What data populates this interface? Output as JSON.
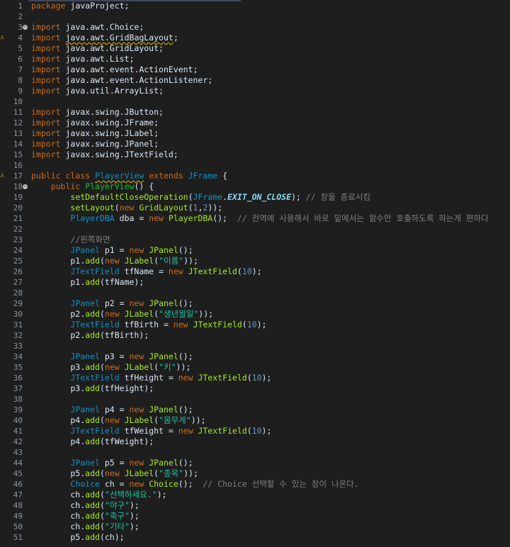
{
  "editor": {
    "lines": [
      {
        "n": "1",
        "parts": [
          [
            "k",
            "package"
          ],
          [
            "p",
            " javaProject;"
          ]
        ]
      },
      {
        "n": "2",
        "parts": []
      },
      {
        "n": "3",
        "fold": true,
        "parts": [
          [
            "k",
            "import"
          ],
          [
            "p",
            " java.awt.Choice;"
          ]
        ]
      },
      {
        "n": "4",
        "warn": true,
        "parts": [
          [
            "k",
            "import"
          ],
          [
            "p",
            " "
          ],
          [
            "u",
            "java.awt.GridBagLayout"
          ],
          [
            "p",
            ";"
          ]
        ]
      },
      {
        "n": "5",
        "parts": [
          [
            "k",
            "import"
          ],
          [
            "p",
            " java.awt.GridLayout;"
          ]
        ]
      },
      {
        "n": "6",
        "parts": [
          [
            "k",
            "import"
          ],
          [
            "p",
            " java.awt.List;"
          ]
        ]
      },
      {
        "n": "7",
        "parts": [
          [
            "k",
            "import"
          ],
          [
            "p",
            " java.awt.event.ActionEvent;"
          ]
        ]
      },
      {
        "n": "8",
        "parts": [
          [
            "k",
            "import"
          ],
          [
            "p",
            " java.awt.event.ActionListener;"
          ]
        ]
      },
      {
        "n": "9",
        "parts": [
          [
            "k",
            "import"
          ],
          [
            "p",
            " java.util.ArrayList;"
          ]
        ]
      },
      {
        "n": "10",
        "parts": []
      },
      {
        "n": "11",
        "parts": [
          [
            "k",
            "import"
          ],
          [
            "p",
            " javax.swing.JButton;"
          ]
        ]
      },
      {
        "n": "12",
        "parts": [
          [
            "k",
            "import"
          ],
          [
            "p",
            " javax.swing.JFrame;"
          ]
        ]
      },
      {
        "n": "13",
        "parts": [
          [
            "k",
            "import"
          ],
          [
            "p",
            " javax.swing.JLabel;"
          ]
        ]
      },
      {
        "n": "14",
        "parts": [
          [
            "k",
            "import"
          ],
          [
            "p",
            " javax.swing.JPanel;"
          ]
        ]
      },
      {
        "n": "15",
        "parts": [
          [
            "k",
            "import"
          ],
          [
            "p",
            " javax.swing.JTextField;"
          ]
        ]
      },
      {
        "n": "16",
        "parts": []
      },
      {
        "n": "17",
        "warn": true,
        "parts": [
          [
            "k",
            "public class"
          ],
          [
            "p",
            " "
          ],
          [
            "tu",
            "PlayerView"
          ],
          [
            "p",
            " "
          ],
          [
            "k",
            "extends"
          ],
          [
            "p",
            " "
          ],
          [
            "t",
            "JFrame"
          ],
          [
            "p",
            " {"
          ]
        ]
      },
      {
        "n": "18",
        "fold": true,
        "parts": [
          [
            "p",
            "    "
          ],
          [
            "k",
            "public"
          ],
          [
            "p",
            " "
          ],
          [
            "f",
            "PlayerView"
          ],
          [
            "p",
            "() {"
          ]
        ]
      },
      {
        "n": "19",
        "parts": [
          [
            "p",
            "        "
          ],
          [
            "m",
            "setDefaultCloseOperation"
          ],
          [
            "p",
            "("
          ],
          [
            "t",
            "JFrame"
          ],
          [
            "p",
            "."
          ],
          [
            "it",
            "EXIT_ON_CLOSE"
          ],
          [
            "p",
            "); "
          ],
          [
            "c",
            "// 창을 종료시킴"
          ]
        ]
      },
      {
        "n": "20",
        "parts": [
          [
            "p",
            "        "
          ],
          [
            "m",
            "setLayout"
          ],
          [
            "p",
            "("
          ],
          [
            "k",
            "new"
          ],
          [
            "p",
            " "
          ],
          [
            "m",
            "GridLayout"
          ],
          [
            "p",
            "("
          ],
          [
            "n",
            "1"
          ],
          [
            "p",
            ","
          ],
          [
            "n",
            "2"
          ],
          [
            "p",
            "));"
          ]
        ]
      },
      {
        "n": "21",
        "parts": [
          [
            "p",
            "        "
          ],
          [
            "t",
            "PlayerDBA"
          ],
          [
            "p",
            " dba = "
          ],
          [
            "k",
            "new"
          ],
          [
            "p",
            " "
          ],
          [
            "m",
            "PlayerDBA"
          ],
          [
            "p",
            "();  "
          ],
          [
            "c",
            "// 전역에 사용해서 바로 밑에서는 함수만 호출하도록 하는게 편하다"
          ]
        ]
      },
      {
        "n": "22",
        "parts": []
      },
      {
        "n": "23",
        "parts": [
          [
            "p",
            "        "
          ],
          [
            "c",
            "//왼쪽화면"
          ]
        ]
      },
      {
        "n": "24",
        "parts": [
          [
            "p",
            "        "
          ],
          [
            "t",
            "JPanel"
          ],
          [
            "p",
            " p1 = "
          ],
          [
            "k",
            "new"
          ],
          [
            "p",
            " "
          ],
          [
            "m",
            "JPanel"
          ],
          [
            "p",
            "();"
          ]
        ]
      },
      {
        "n": "25",
        "parts": [
          [
            "p",
            "        p1."
          ],
          [
            "m",
            "add"
          ],
          [
            "p",
            "("
          ],
          [
            "k",
            "new"
          ],
          [
            "p",
            " "
          ],
          [
            "m",
            "JLabel"
          ],
          [
            "p",
            "("
          ],
          [
            "s",
            "\"이름\""
          ],
          [
            "p",
            "));"
          ]
        ]
      },
      {
        "n": "26",
        "parts": [
          [
            "p",
            "        "
          ],
          [
            "t",
            "JTextField"
          ],
          [
            "p",
            " tfName = "
          ],
          [
            "k",
            "new"
          ],
          [
            "p",
            " "
          ],
          [
            "m",
            "JTextField"
          ],
          [
            "p",
            "("
          ],
          [
            "n",
            "10"
          ],
          [
            "p",
            ");"
          ]
        ]
      },
      {
        "n": "27",
        "parts": [
          [
            "p",
            "        p1."
          ],
          [
            "m",
            "add"
          ],
          [
            "p",
            "(tfName);"
          ]
        ]
      },
      {
        "n": "28",
        "parts": []
      },
      {
        "n": "29",
        "parts": [
          [
            "p",
            "        "
          ],
          [
            "t",
            "JPanel"
          ],
          [
            "p",
            " p2 = "
          ],
          [
            "k",
            "new"
          ],
          [
            "p",
            " "
          ],
          [
            "m",
            "JPanel"
          ],
          [
            "p",
            "();"
          ]
        ]
      },
      {
        "n": "30",
        "parts": [
          [
            "p",
            "        p2."
          ],
          [
            "m",
            "add"
          ],
          [
            "p",
            "("
          ],
          [
            "k",
            "new"
          ],
          [
            "p",
            " "
          ],
          [
            "m",
            "JLabel"
          ],
          [
            "p",
            "("
          ],
          [
            "s",
            "\"생년월일\""
          ],
          [
            "p",
            "));"
          ]
        ]
      },
      {
        "n": "31",
        "parts": [
          [
            "p",
            "        "
          ],
          [
            "t",
            "JTextField"
          ],
          [
            "p",
            " tfBirth = "
          ],
          [
            "k",
            "new"
          ],
          [
            "p",
            " "
          ],
          [
            "m",
            "JTextField"
          ],
          [
            "p",
            "("
          ],
          [
            "n",
            "10"
          ],
          [
            "p",
            ");"
          ]
        ]
      },
      {
        "n": "32",
        "parts": [
          [
            "p",
            "        p2."
          ],
          [
            "m",
            "add"
          ],
          [
            "p",
            "(tfBirth);"
          ]
        ]
      },
      {
        "n": "33",
        "parts": []
      },
      {
        "n": "34",
        "parts": [
          [
            "p",
            "        "
          ],
          [
            "t",
            "JPanel"
          ],
          [
            "p",
            " p3 = "
          ],
          [
            "k",
            "new"
          ],
          [
            "p",
            " "
          ],
          [
            "m",
            "JPanel"
          ],
          [
            "p",
            "();"
          ]
        ]
      },
      {
        "n": "35",
        "parts": [
          [
            "p",
            "        p3."
          ],
          [
            "m",
            "add"
          ],
          [
            "p",
            "("
          ],
          [
            "k",
            "new"
          ],
          [
            "p",
            " "
          ],
          [
            "m",
            "JLabel"
          ],
          [
            "p",
            "("
          ],
          [
            "s",
            "\"키\""
          ],
          [
            "p",
            "));"
          ]
        ]
      },
      {
        "n": "36",
        "parts": [
          [
            "p",
            "        "
          ],
          [
            "t",
            "JTextField"
          ],
          [
            "p",
            " tfHeight = "
          ],
          [
            "k",
            "new"
          ],
          [
            "p",
            " "
          ],
          [
            "m",
            "JTextField"
          ],
          [
            "p",
            "("
          ],
          [
            "n",
            "10"
          ],
          [
            "p",
            ");"
          ]
        ]
      },
      {
        "n": "37",
        "parts": [
          [
            "p",
            "        p3."
          ],
          [
            "m",
            "add"
          ],
          [
            "p",
            "(tfHeight);"
          ]
        ]
      },
      {
        "n": "38",
        "parts": []
      },
      {
        "n": "39",
        "parts": [
          [
            "p",
            "        "
          ],
          [
            "t",
            "JPanel"
          ],
          [
            "p",
            " p4 = "
          ],
          [
            "k",
            "new"
          ],
          [
            "p",
            " "
          ],
          [
            "m",
            "JPanel"
          ],
          [
            "p",
            "();"
          ]
        ]
      },
      {
        "n": "40",
        "parts": [
          [
            "p",
            "        p4."
          ],
          [
            "m",
            "add"
          ],
          [
            "p",
            "("
          ],
          [
            "k",
            "new"
          ],
          [
            "p",
            " "
          ],
          [
            "m",
            "JLabel"
          ],
          [
            "p",
            "("
          ],
          [
            "s",
            "\"몸무게\""
          ],
          [
            "p",
            "));"
          ]
        ]
      },
      {
        "n": "41",
        "parts": [
          [
            "p",
            "        "
          ],
          [
            "t",
            "JTextField"
          ],
          [
            "p",
            " tfWeight = "
          ],
          [
            "k",
            "new"
          ],
          [
            "p",
            " "
          ],
          [
            "m",
            "JTextField"
          ],
          [
            "p",
            "("
          ],
          [
            "n",
            "10"
          ],
          [
            "p",
            ");"
          ]
        ]
      },
      {
        "n": "42",
        "parts": [
          [
            "p",
            "        p4."
          ],
          [
            "m",
            "add"
          ],
          [
            "p",
            "(tfWeight);"
          ]
        ]
      },
      {
        "n": "43",
        "parts": []
      },
      {
        "n": "44",
        "parts": [
          [
            "p",
            "        "
          ],
          [
            "t",
            "JPanel"
          ],
          [
            "p",
            " p5 = "
          ],
          [
            "k",
            "new"
          ],
          [
            "p",
            " "
          ],
          [
            "m",
            "JPanel"
          ],
          [
            "p",
            "();"
          ]
        ]
      },
      {
        "n": "45",
        "parts": [
          [
            "p",
            "        p5."
          ],
          [
            "m",
            "add"
          ],
          [
            "p",
            "("
          ],
          [
            "k",
            "new"
          ],
          [
            "p",
            " "
          ],
          [
            "m",
            "JLabel"
          ],
          [
            "p",
            "("
          ],
          [
            "s",
            "\"종목\""
          ],
          [
            "p",
            "));"
          ]
        ]
      },
      {
        "n": "46",
        "parts": [
          [
            "p",
            "        "
          ],
          [
            "t",
            "Choice"
          ],
          [
            "p",
            " ch = "
          ],
          [
            "k",
            "new"
          ],
          [
            "p",
            " "
          ],
          [
            "m",
            "Choice"
          ],
          [
            "p",
            "();  "
          ],
          [
            "c",
            "// Choice 선택할 수 있는 창이 나온다."
          ]
        ]
      },
      {
        "n": "47",
        "parts": [
          [
            "p",
            "        ch."
          ],
          [
            "m",
            "add"
          ],
          [
            "p",
            "("
          ],
          [
            "s",
            "\"선택하세요.\""
          ],
          [
            "p",
            ");"
          ]
        ]
      },
      {
        "n": "48",
        "parts": [
          [
            "p",
            "        ch."
          ],
          [
            "m",
            "add"
          ],
          [
            "p",
            "("
          ],
          [
            "s",
            "\"야구\""
          ],
          [
            "p",
            ");"
          ]
        ]
      },
      {
        "n": "49",
        "parts": [
          [
            "p",
            "        ch."
          ],
          [
            "m",
            "add"
          ],
          [
            "p",
            "("
          ],
          [
            "s",
            "\"축구\""
          ],
          [
            "p",
            ");"
          ]
        ]
      },
      {
        "n": "50",
        "parts": [
          [
            "p",
            "        ch."
          ],
          [
            "m",
            "add"
          ],
          [
            "p",
            "("
          ],
          [
            "s",
            "\"기타\""
          ],
          [
            "p",
            ");"
          ]
        ]
      },
      {
        "n": "51",
        "parts": [
          [
            "p",
            "        p5."
          ],
          [
            "m",
            "add"
          ],
          [
            "p",
            "(ch);"
          ]
        ]
      }
    ]
  }
}
